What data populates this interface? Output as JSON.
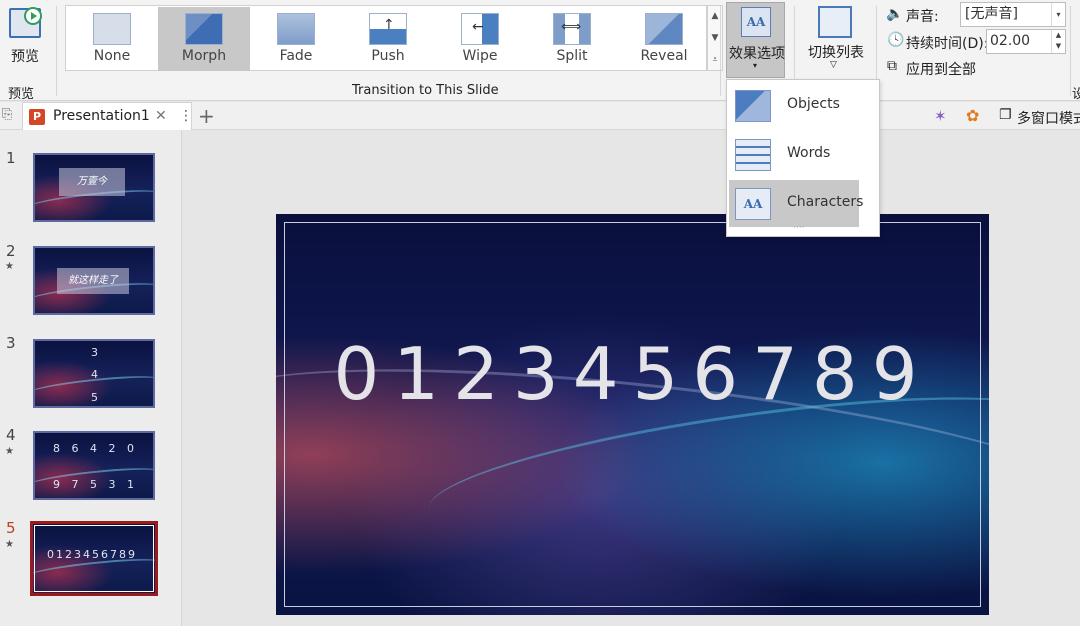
{
  "ribbon": {
    "preview_label": "预览",
    "preview_group": "预览",
    "gallery_group": "Transition to This Slide",
    "transitions": [
      "None",
      "Morph",
      "Fade",
      "Push",
      "Wipe",
      "Split",
      "Reveal"
    ],
    "selected_transition": "Morph",
    "effects_label": "效果选项",
    "switch_label": "切换列表",
    "sound_label": "声音:",
    "sound_value": "[无声音]",
    "duration_label": "持续时间(D):",
    "duration_value": "02.00",
    "apply_all_label": "应用到全部",
    "extra_label": "设"
  },
  "tabbar": {
    "doc_title": "Presentation1",
    "close": "✕",
    "more": "⋮",
    "add": "+",
    "multi_window": "多窗口模式",
    "multi_window_prefix": "多窗口模式"
  },
  "effect_menu": {
    "items": [
      {
        "label": "Objects"
      },
      {
        "label": "Words"
      },
      {
        "label": "Characters"
      }
    ],
    "selected": "Characters"
  },
  "slides": [
    {
      "num": "1",
      "text": "万壹今"
    },
    {
      "num": "2",
      "text": "就这样走了",
      "star": "★"
    },
    {
      "num": "3",
      "lines": [
        "3",
        "4",
        "5"
      ]
    },
    {
      "num": "4",
      "lines": [
        "8 6 4 2 0",
        "9 7 5 3 1"
      ],
      "star": "★"
    },
    {
      "num": "5",
      "text": "0123456789",
      "star": "★",
      "current": true
    }
  ],
  "canvas": {
    "digits": "0123456789"
  },
  "colors": {
    "accent": "#c0401f",
    "ribbon_bg": "#f3f3f3",
    "slide_bg": "#101a55"
  }
}
